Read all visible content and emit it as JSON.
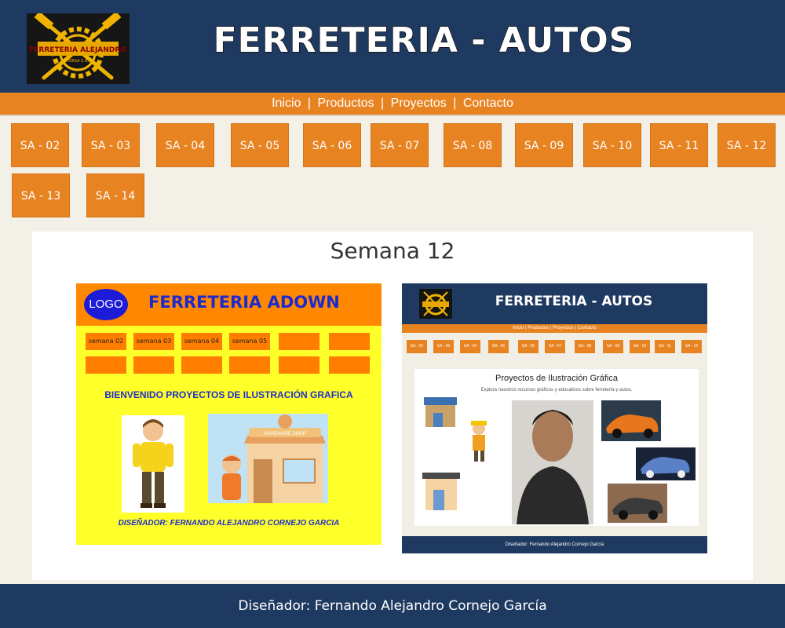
{
  "header": {
    "logo_text": "FERRETERIA ALEJANDRO",
    "logo_subtext": "JOYERSA S.A.C.",
    "title": "FERRETERIA - AUTOS"
  },
  "nav": {
    "items": [
      "Inicio",
      "Productos",
      "Proyectos",
      "Contacto"
    ],
    "separator": "|"
  },
  "sa_buttons": [
    "SA - 02",
    "SA - 03",
    "SA - 04",
    "SA - 05",
    "SA - 06",
    "SA - 07",
    "SA - 08",
    "SA - 09",
    "SA - 10",
    "SA - 11",
    "SA - 12",
    "SA - 13",
    "SA - 14"
  ],
  "main": {
    "title": "Semana 12"
  },
  "preview_left": {
    "logo": "LOGO",
    "title": "FERRETERIA ADOWN",
    "buttons": [
      "semana 02",
      "semana 03",
      "semana 04",
      "semana 05"
    ],
    "welcome": "BIENVENIDO PROYECTOS DE ILUSTRACIÓN GRAFICA",
    "shop_sign": "HARDWARE SHOP",
    "designer": "DISEÑADOR: FERNANDO ALEJANDRO CORNEJO GARCIA"
  },
  "preview_right": {
    "title": "FERRETERIA - AUTOS",
    "nav": "Inicio | Productos | Proyectos | Contacto",
    "buttons": [
      "SA - 02",
      "SA - 03",
      "SA - 04",
      "SA - 05",
      "SA - 06",
      "SA - 07",
      "SA - 08",
      "SA - 09",
      "SA - 10",
      "SA - 11",
      "SA - 12"
    ],
    "panel_title": "Proyectos de Ilustración Gráfica",
    "panel_subtitle": "Explora nuestros recursos gráficos y educativos sobre ferretería y autos.",
    "footer": "Diseñador: Fernando Alejandro Cornejo García"
  },
  "footer": {
    "text": "Diseñador: Fernando Alejandro Cornejo García"
  },
  "colors": {
    "navy": "#1f3a60",
    "orange": "#e88321",
    "background": "#f3f1e7",
    "yellow": "#ffff2a"
  }
}
